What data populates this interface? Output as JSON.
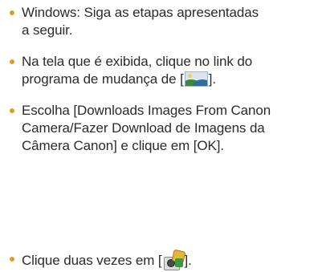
{
  "bullet_color": "#e69a1c",
  "items": [
    {
      "lines": [
        "Windows: Siga as etapas apresentadas",
        "a seguir."
      ]
    },
    {
      "line1": "Na tela que é exibida, clique no link do",
      "line2_before": "programa de mudança de [",
      "line2_after": "].",
      "icon": "landscape-picture-icon"
    },
    {
      "lines": [
        "Escolha [Downloads Images From Canon",
        "Camera/Fazer Download de Imagens da",
        "Câmera Canon] e clique em [OK]."
      ]
    },
    {
      "before": "Clique duas vezes em [",
      "after": "].",
      "icon": "camera-transfer-app-icon"
    }
  ]
}
